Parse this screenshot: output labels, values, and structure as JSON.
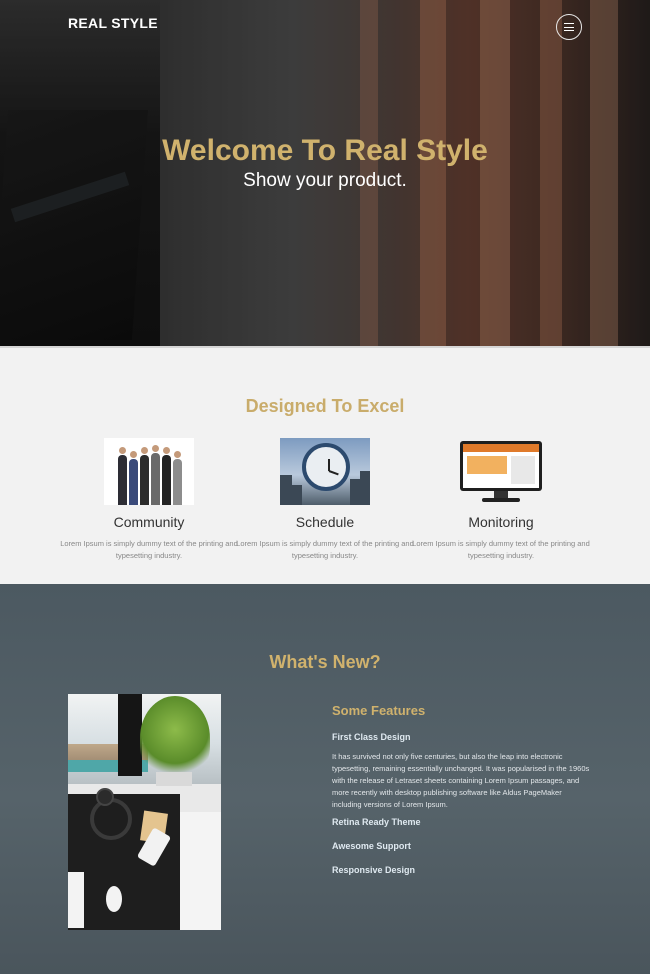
{
  "header": {
    "brand": "REAL STYLE",
    "menu_icon": "hamburger-menu-icon"
  },
  "hero": {
    "title": "Welcome To Real Style",
    "subtitle": "Show your product."
  },
  "features": {
    "heading": "Designed To Excel",
    "items": [
      {
        "name": "Community",
        "description": "Lorem Ipsum is simply dummy text of the printing and typesetting industry.",
        "image": "community-photo"
      },
      {
        "name": "Schedule",
        "description": "Lorem Ipsum is simply dummy text of the printing and typesetting industry.",
        "image": "clock-photo"
      },
      {
        "name": "Monitoring",
        "description": "Lorem Ipsum is simply dummy text of the printing and typesetting industry.",
        "image": "monitor-photo"
      }
    ]
  },
  "whats_new": {
    "heading": "What's New?",
    "subheading": "Some Features",
    "items": [
      {
        "title": "First Class Design",
        "body": "It has survived not only five centuries, but also the leap into electronic typesetting, remaining essentially unchanged. It was popularised in the 1960s with the release of Letraset sheets containing Lorem Ipsum passages, and more recently with desktop publishing software like Aldus PageMaker including versions of Lorem Ipsum."
      },
      {
        "title": "Retina Ready Theme"
      },
      {
        "title": "Awesome Support"
      },
      {
        "title": "Responsive Design"
      }
    ]
  },
  "colors": {
    "accent_gold": "#d0b26d",
    "section_light": "#f2f2f2",
    "section_dark": "#4e5960"
  }
}
